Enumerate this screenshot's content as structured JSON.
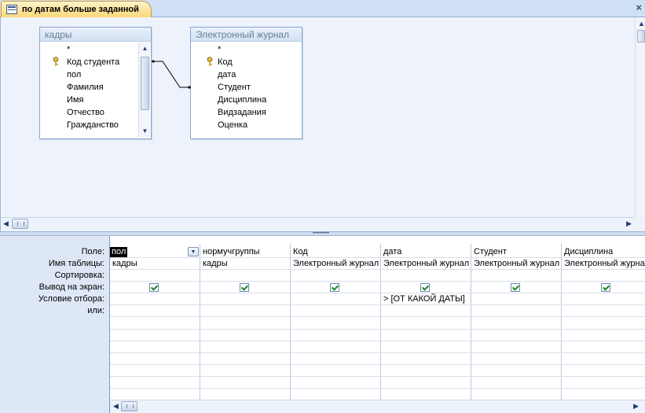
{
  "tab": {
    "title": "по датам больше заданной",
    "close": "×"
  },
  "tables": [
    {
      "title": "кадры",
      "fields": [
        "*",
        "Код студента",
        "пол",
        "Фамилия",
        "Имя",
        "Отчество",
        "Гражданство"
      ],
      "key_field": "Код студента"
    },
    {
      "title": "Электронный журнал",
      "fields": [
        "*",
        "Код",
        "дата",
        "Студент",
        "Дисциплина",
        "Видзадания",
        "Оценка"
      ],
      "key_field": "Код"
    }
  ],
  "grid": {
    "row_labels": [
      "Поле:",
      "Имя таблицы:",
      "Сортировка:",
      "Вывод на экран:",
      "Условие отбора:",
      "или:"
    ],
    "columns": [
      {
        "field": "пол",
        "table": "кадры",
        "show": true,
        "criteria": ""
      },
      {
        "field": "нормучгруппы",
        "table": "кадры",
        "show": true,
        "criteria": ""
      },
      {
        "field": "Код",
        "table": "Электронный журнал",
        "show": true,
        "criteria": ""
      },
      {
        "field": "дата",
        "table": "Электронный журнал",
        "show": true,
        "criteria": "> [ОТ КАКОЙ ДАТЫ]"
      },
      {
        "field": "Студент",
        "table": "Электронный журнал",
        "show": true,
        "criteria": ""
      },
      {
        "field": "Дисциплина",
        "table": "Электронный журнал",
        "show": true,
        "criteria": ""
      }
    ]
  },
  "icons": {
    "tab": "query-icon",
    "key": "primary-key-icon",
    "dropdown": "chevron-down-icon"
  },
  "colors": {
    "tab_active": "#fbd878",
    "pane_bg": "#eef3fb",
    "label_col_bg": "#dde7f5",
    "checkbox_mark": "#1a8a2a"
  }
}
